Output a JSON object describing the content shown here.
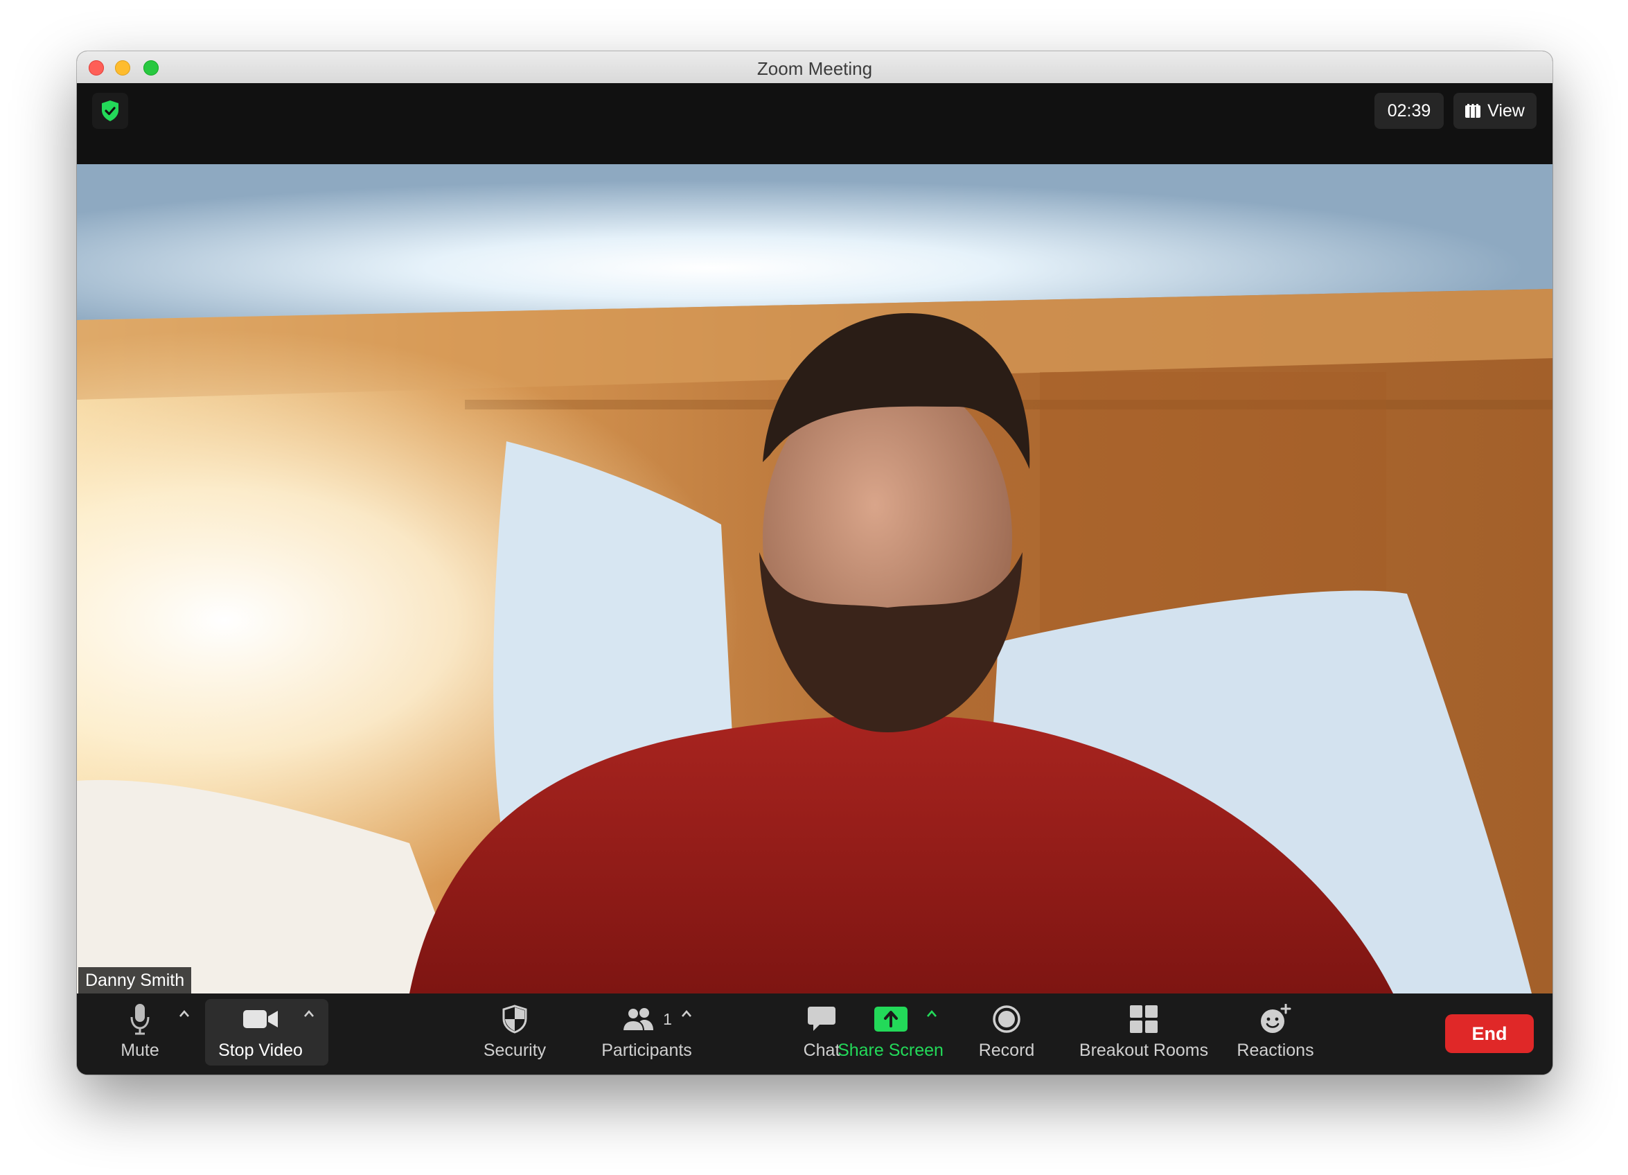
{
  "window": {
    "title": "Zoom Meeting"
  },
  "topbar": {
    "timer": "02:39",
    "view_label": "View"
  },
  "video": {
    "participant_name": "Danny Smith"
  },
  "toolbar": {
    "mute_label": "Mute",
    "stop_video_label": "Stop Video",
    "security_label": "Security",
    "participants_label": "Participants",
    "participants_count": "1",
    "chat_label": "Chat",
    "share_screen_label": "Share Screen",
    "record_label": "Record",
    "breakout_rooms_label": "Breakout Rooms",
    "reactions_label": "Reactions",
    "end_label": "End"
  },
  "colors": {
    "share_green": "#23d959",
    "end_red": "#e02828",
    "shield_green": "#23d959"
  },
  "icons": [
    "shield-check-icon",
    "grid-view-icon",
    "microphone-icon",
    "video-camera-icon",
    "security-shield-icon",
    "participants-icon",
    "chat-bubble-icon",
    "share-screen-icon",
    "record-icon",
    "breakout-rooms-icon",
    "reactions-icon"
  ]
}
